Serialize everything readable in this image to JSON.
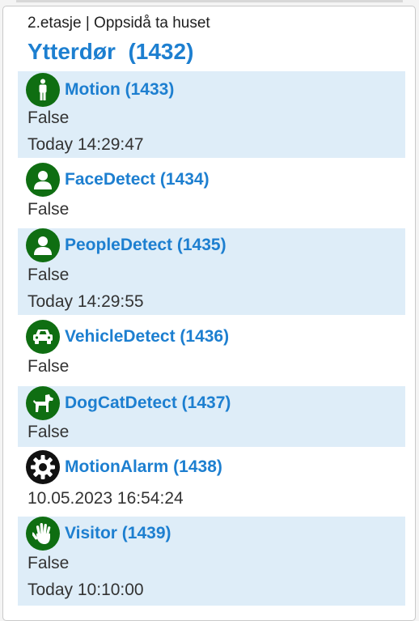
{
  "colors": {
    "accent": "#1d7fd0",
    "row_shade": "#deedf8",
    "icon_green": "#0f6e12",
    "icon_black": "#111111"
  },
  "header": {
    "breadcrumb": "2.etasje | Oppsidå ta huset",
    "device_title": "Ytterdør  (1432)"
  },
  "items": [
    {
      "icon": "person-standing-icon",
      "title": "Motion (1433)",
      "value": "False",
      "time": "Today 14:29:47"
    },
    {
      "icon": "face-person-icon",
      "title": "FaceDetect (1434)",
      "value": "False"
    },
    {
      "icon": "person-icon",
      "title": "PeopleDetect (1435)",
      "value": "False",
      "time": "Today 14:29:55"
    },
    {
      "icon": "car-icon",
      "title": "VehicleDetect (1436)",
      "value": "False"
    },
    {
      "icon": "dog-icon",
      "title": "DogCatDetect (1437)",
      "value": "False"
    },
    {
      "icon": "gear-icon",
      "title": "MotionAlarm (1438)",
      "value": "10.05.2023 16:54:24"
    },
    {
      "icon": "hand-wave-icon",
      "title": "Visitor (1439)",
      "value": "False",
      "time": "Today 10:10:00"
    }
  ]
}
